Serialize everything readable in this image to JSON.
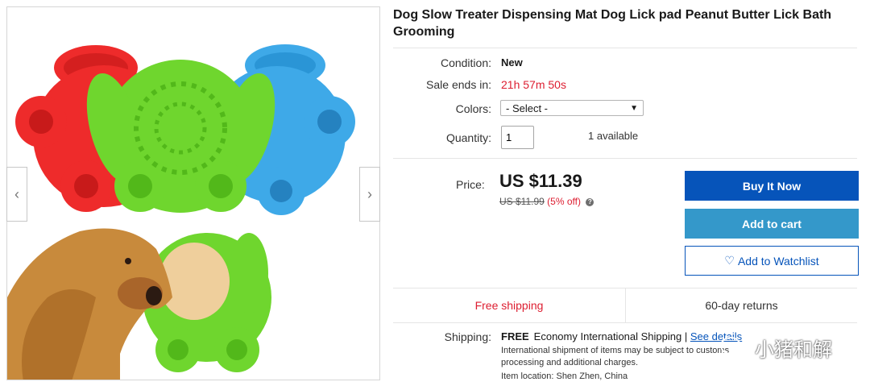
{
  "listing": {
    "title": "Dog Slow Treater Dispensing Mat Dog Lick pad Peanut Butter Lick Bath Grooming"
  },
  "details": {
    "condition_label": "Condition:",
    "condition_value": "New",
    "sale_label": "Sale ends in:",
    "sale_value": "21h 57m 50s",
    "colors_label": "Colors:",
    "colors_selected": "- Select -",
    "quantity_label": "Quantity:",
    "quantity_value": "1",
    "available": "1 available"
  },
  "price": {
    "label": "Price:",
    "current": "US $11.39",
    "original": "US $11.99",
    "discount": "(5% off)"
  },
  "buttons": {
    "buy_now": "Buy It Now",
    "add_to_cart": "Add to cart",
    "watchlist": "Add to Watchlist"
  },
  "shipping_summary": {
    "free_shipping": "Free shipping",
    "returns": "60-day returns"
  },
  "shipping": {
    "label": "Shipping:",
    "free": "FREE",
    "method": "Economy International Shipping |",
    "details_link": "See details",
    "note": "International shipment of items may be subject to customs processing and additional charges.",
    "location": "Item location: Shen Zhen, China"
  },
  "watermark": {
    "text": "小猪和解"
  },
  "colors": {
    "accent_blue": "#0654ba",
    "cart_blue": "#3498ca",
    "sale_red": "#dd1e31",
    "mat_red": "#ee2b2b",
    "mat_green": "#6fd62e",
    "mat_blue": "#3ea9e8"
  }
}
